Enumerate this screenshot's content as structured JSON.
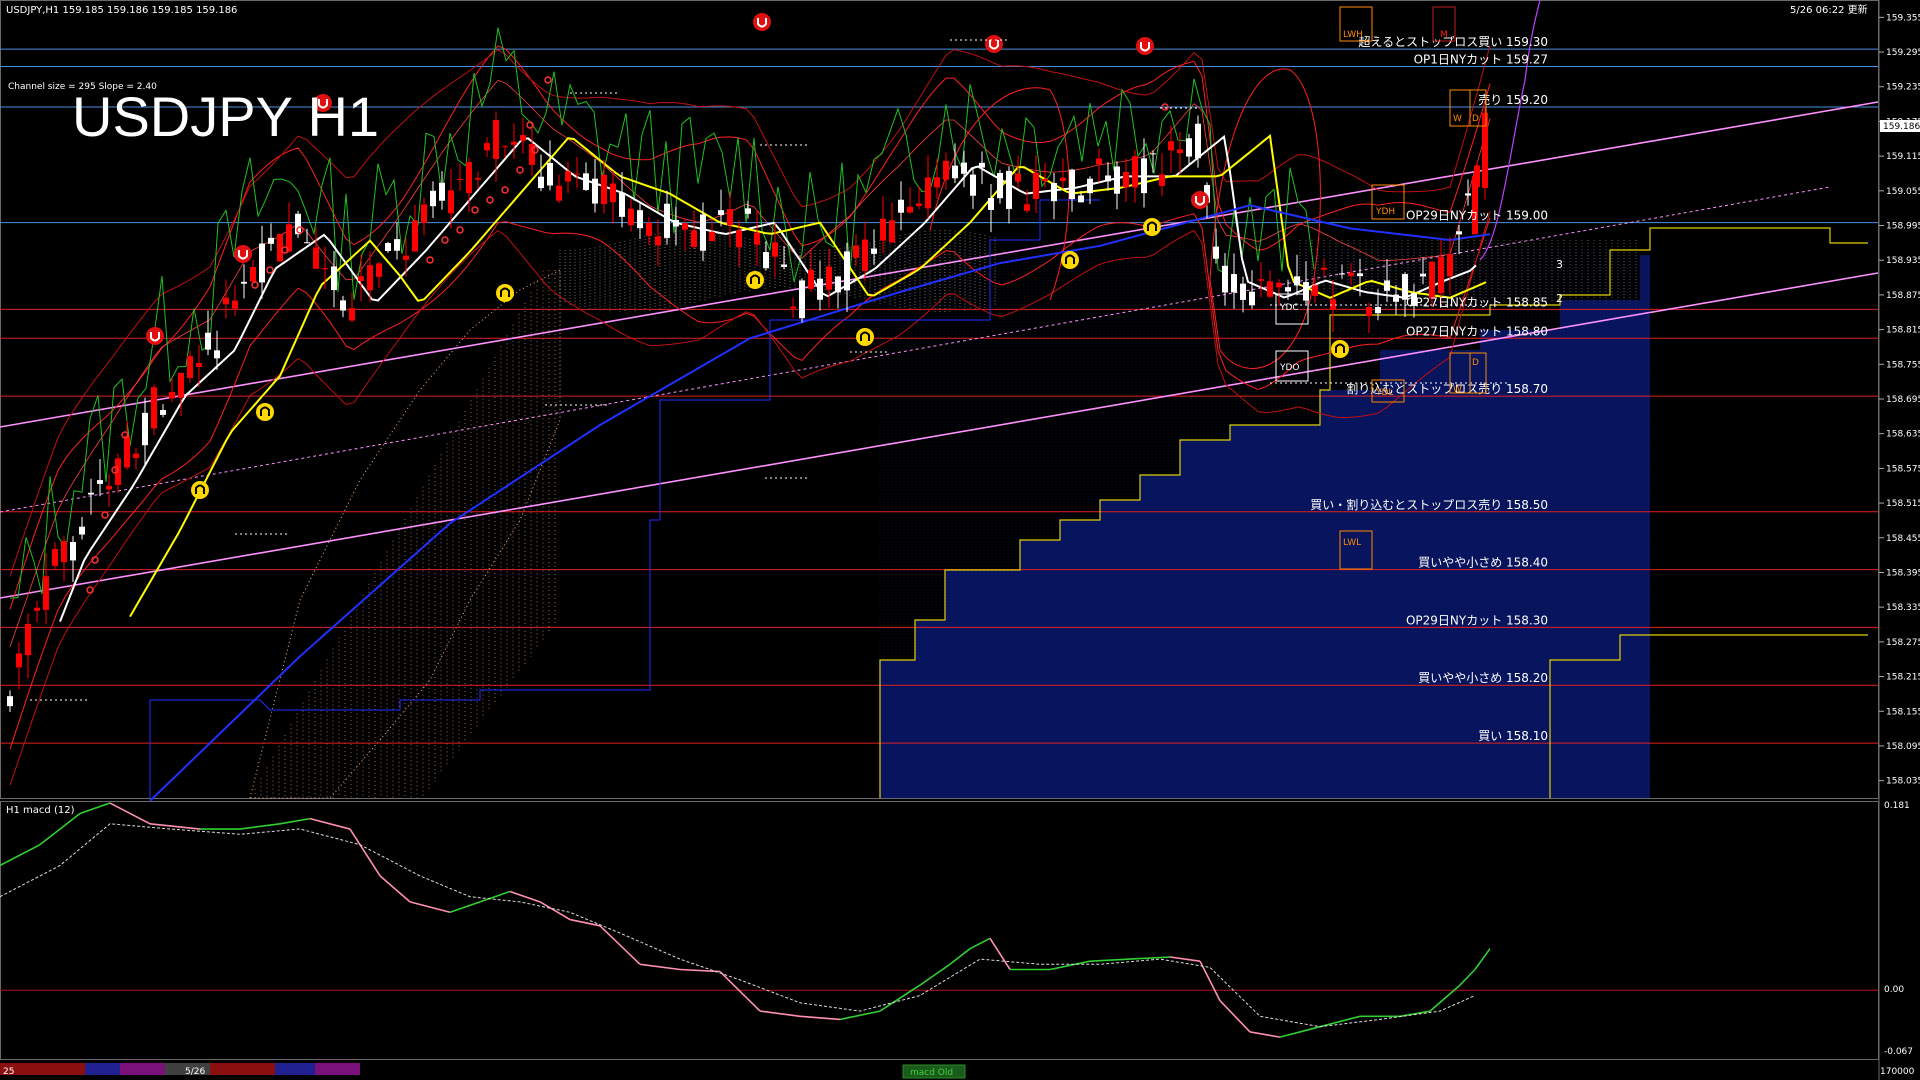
{
  "window": {
    "symbol_info": "USDJPY,H1  159.185 159.186 159.185 159.186",
    "datetime": "5/26 06:22 更新",
    "big_title": "USDJPY H1",
    "channel_info": "Channel size = 295  Slope = 2.40"
  },
  "indicator": {
    "name": "H1  macd (12)",
    "axis_labels": [
      "0.181",
      "0.00",
      "-0.067"
    ],
    "bottom_right": "170000"
  },
  "price_axis": {
    "current_price": "159.186",
    "ticks": [
      "159.355",
      "159.295",
      "159.235",
      "159.175",
      "159.115",
      "159.055",
      "158.995",
      "158.935",
      "158.875",
      "158.815",
      "158.755",
      "158.695",
      "158.635",
      "158.575",
      "158.515",
      "158.455",
      "158.395",
      "158.335",
      "158.275",
      "158.215",
      "158.155",
      "158.095",
      "158.035"
    ]
  },
  "levels": [
    {
      "label": "超えるとストップロス買い 159.30",
      "price": 159.3,
      "color": "#4a90e2"
    },
    {
      "label": "OP1日NYカット 159.27",
      "price": 159.27,
      "color": "#4a90e2"
    },
    {
      "label": "売り 159.20",
      "price": 159.2,
      "color": "#4a90e2"
    },
    {
      "label": "OP29日NYカット 159.00",
      "price": 159.0,
      "color": "#4a90e2"
    },
    {
      "label": "OP27日NYカット 158.85",
      "price": 158.85,
      "color": "#e02020"
    },
    {
      "label": "OP27日NYカット 158.80",
      "price": 158.8,
      "color": "#e02020"
    },
    {
      "label": "割り込むとストップロス売り 158.70",
      "price": 158.7,
      "color": "#e02020"
    },
    {
      "label": "買い・割り込むとストップロス売り 158.50",
      "price": 158.5,
      "color": "#e02020"
    },
    {
      "label": "買いやや小さめ 158.40",
      "price": 158.4,
      "color": "#e02020"
    },
    {
      "label": "OP29日NYカット 158.30",
      "price": 158.3,
      "color": "#e02020"
    },
    {
      "label": "買いやや小さめ 158.20",
      "price": 158.2,
      "color": "#e02020"
    },
    {
      "label": "買い 158.10",
      "price": 158.1,
      "color": "#e02020"
    }
  ],
  "markers": {
    "ydh": "YDH",
    "ydc": "YDC",
    "ydo": "YDO",
    "ydl": "YDL",
    "lwh": "LWH",
    "lwl": "LWL",
    "w": "W",
    "d": "D",
    "m": "M",
    "ch_upper": "3",
    "ch_lower": "2"
  },
  "timebar": {
    "date_label": "5/26",
    "left_label": "25",
    "tab_label": "macd Old"
  },
  "colors": {
    "bull": "#ffffff",
    "bear": "#ff0000",
    "ma_fast": "#ffffff",
    "ma_mid": "#ffff00",
    "ma_slow": "#2030ff",
    "cloud": "#ffb380",
    "fib": "#ffa040",
    "channel": "#ff80ff",
    "macd_up": "#30d030",
    "macd_down": "#ff90b0",
    "grid_blue": "#4a90e2",
    "grid_red": "#e02020"
  }
}
